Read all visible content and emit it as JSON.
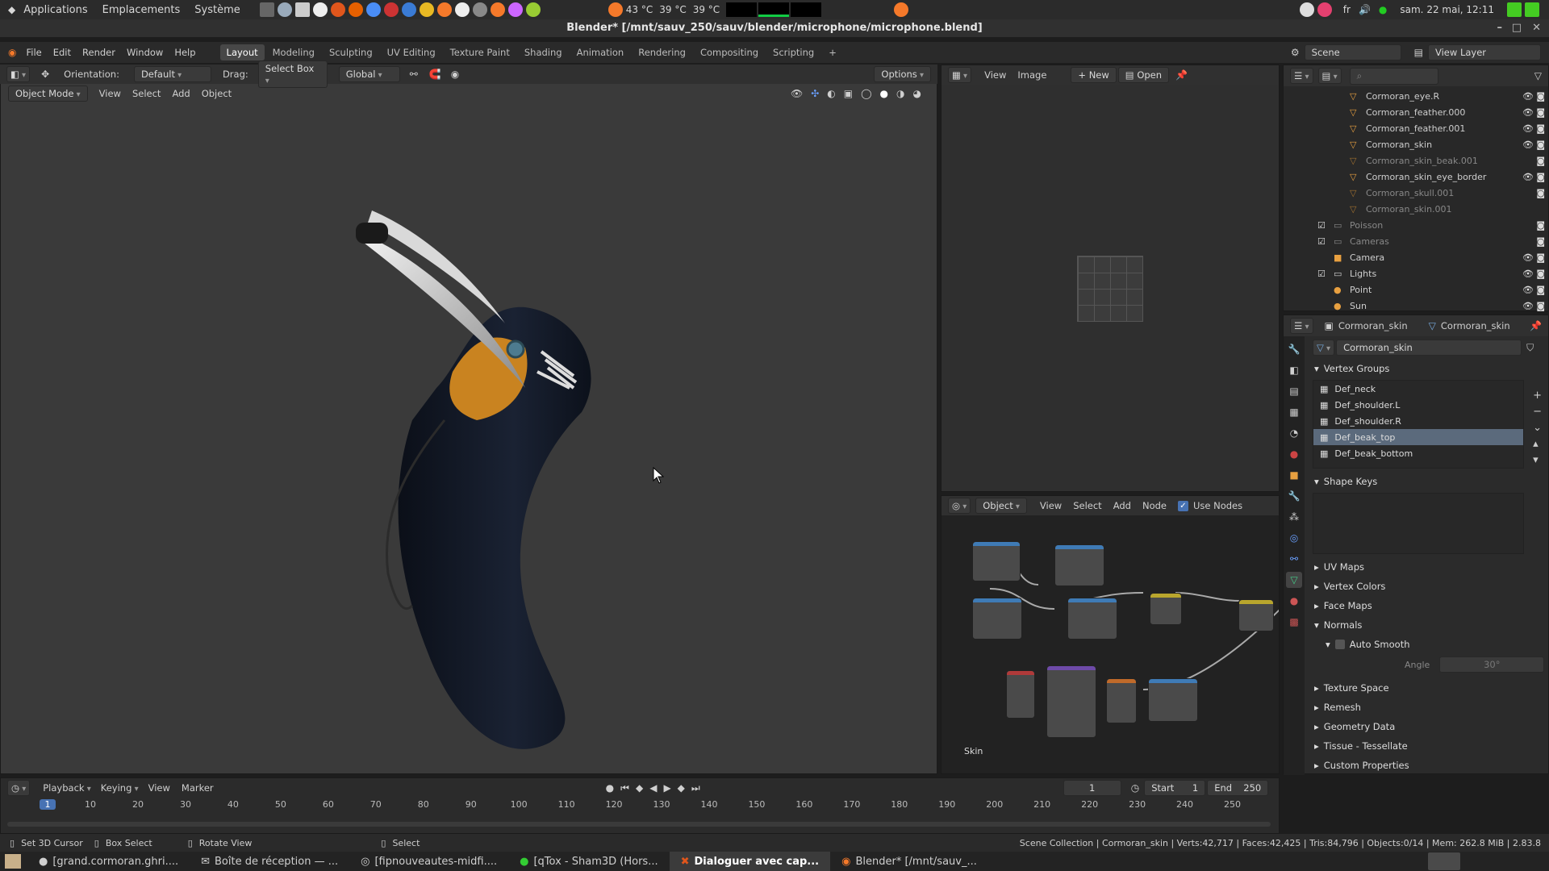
{
  "sysbar": {
    "menus": [
      "Applications",
      "Emplacements",
      "Système"
    ],
    "temps": [
      "43 °C",
      "39 °C",
      "39 °C"
    ],
    "lang": "fr",
    "datetime": "sam. 22 mai, 12:11"
  },
  "window": {
    "title": "Blender* [/mnt/sauv_250/sauv/blender/microphone/microphone.blend]"
  },
  "menu": {
    "items": [
      "File",
      "Edit",
      "Render",
      "Window",
      "Help"
    ],
    "workspaces": [
      "Layout",
      "Modeling",
      "Sculpting",
      "UV Editing",
      "Texture Paint",
      "Shading",
      "Animation",
      "Rendering",
      "Compositing",
      "Scripting"
    ],
    "active_workspace": "Layout",
    "scene": "Scene",
    "view_layer": "View Layer"
  },
  "viewport": {
    "orientation_label": "Orientation:",
    "orientation": "Default",
    "drag_label": "Drag:",
    "drag": "Select Box",
    "transform": "Global",
    "options": "Options",
    "mode": "Object Mode",
    "menu": [
      "View",
      "Select",
      "Add",
      "Object"
    ]
  },
  "image_editor": {
    "menu": [
      "View",
      "Image"
    ],
    "new": "New",
    "open": "Open"
  },
  "node_editor": {
    "type": "Object",
    "menu": [
      "View",
      "Select",
      "Add",
      "Node"
    ],
    "use_nodes": "Use Nodes",
    "material_label": "Skin"
  },
  "outliner": {
    "rows": [
      {
        "name": "Cormoran_eye.R",
        "dim": false,
        "indent": 4
      },
      {
        "name": "Cormoran_feather.000",
        "dim": false,
        "indent": 4
      },
      {
        "name": "Cormoran_feather.001",
        "dim": false,
        "indent": 4
      },
      {
        "name": "Cormoran_skin",
        "dim": false,
        "indent": 4
      },
      {
        "name": "Cormoran_skin_beak.001",
        "dim": true,
        "indent": 4
      },
      {
        "name": "Cormoran_skin_eye_border",
        "dim": false,
        "indent": 4
      },
      {
        "name": "Cormoran_skull.001",
        "dim": true,
        "indent": 4
      },
      {
        "name": "Cormoran_skin.001",
        "dim": true,
        "indent": 4
      },
      {
        "name": "Poisson",
        "dim": true,
        "indent": 2
      },
      {
        "name": "Cameras",
        "dim": true,
        "indent": 2
      },
      {
        "name": "Camera",
        "dim": false,
        "indent": 3
      },
      {
        "name": "Lights",
        "dim": false,
        "indent": 2
      },
      {
        "name": "Point",
        "dim": false,
        "indent": 3
      },
      {
        "name": "Sun",
        "dim": false,
        "indent": 3
      }
    ]
  },
  "properties": {
    "object": "Cormoran_skin",
    "data": "Cormoran_skin",
    "mesh_name": "Cormoran_skin",
    "vertex_groups_title": "Vertex Groups",
    "vertex_groups": [
      "Def_neck",
      "Def_shoulder.L",
      "Def_shoulder.R",
      "Def_beak_top",
      "Def_beak_bottom"
    ],
    "selected_group": 3,
    "shape_keys_title": "Shape Keys",
    "panels_a": [
      "UV Maps",
      "Vertex Colors",
      "Face Maps"
    ],
    "normals": "Normals",
    "auto_smooth": "Auto Smooth",
    "angle_label": "Angle",
    "angle": "30°",
    "panels_b": [
      "Texture Space",
      "Remesh",
      "Geometry Data",
      "Tissue - Tessellate",
      "Custom Properties"
    ]
  },
  "timeline": {
    "menu": [
      "Playback",
      "Keying",
      "View",
      "Marker"
    ],
    "current_frame": "1",
    "start_label": "Start",
    "start": "1",
    "end_label": "End",
    "end": "250",
    "ticks": [
      "1",
      "10",
      "20",
      "30",
      "40",
      "50",
      "60",
      "70",
      "80",
      "90",
      "100",
      "110",
      "120",
      "130",
      "140",
      "150",
      "160",
      "170",
      "180",
      "190",
      "200",
      "210",
      "220",
      "230",
      "240",
      "250"
    ]
  },
  "status": {
    "left": [
      "Set 3D Cursor",
      "Box Select",
      "Rotate View",
      "Select"
    ],
    "stats": "Scene Collection | Cormoran_skin | Verts:42,717 | Faces:42,425 | Tris:84,796 | Objects:0/14 | Mem: 262.8 MiB | 2.83.8"
  },
  "taskbar": {
    "tasks": [
      "[grand.cormoran.ghri....",
      "Boîte de réception — ...",
      "[fipnouveautes-midfi....",
      "[qTox - Sham3D (Hors...",
      "Dialoguer avec cap...",
      "Blender* [/mnt/sauv_..."
    ],
    "active": 4
  }
}
